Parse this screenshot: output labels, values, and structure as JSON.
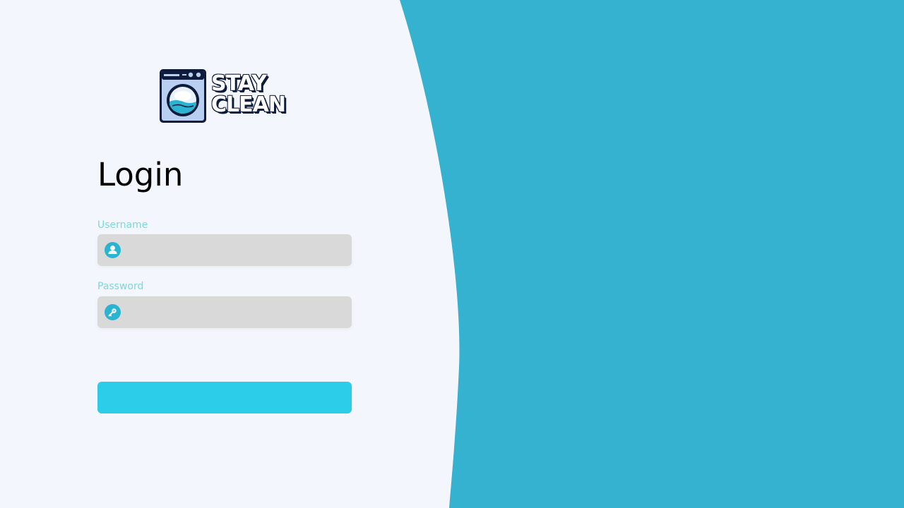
{
  "brand": {
    "name_line1": "STAY",
    "name_line2": "CLEAN",
    "logo_icon": "washing-machine-icon"
  },
  "login": {
    "title": "Login",
    "username_label": "Username",
    "username_value": "",
    "username_icon": "user-icon",
    "password_label": "Password",
    "password_value": "",
    "password_icon": "key-icon",
    "submit_label": ""
  },
  "colors": {
    "background": "#f3f6fd",
    "accent_panel": "#34b2cf",
    "label": "#7ed6e0",
    "input_bg": "#d9d9d9",
    "icon_bg": "#2bb4d1",
    "button": "#2bcde8"
  }
}
